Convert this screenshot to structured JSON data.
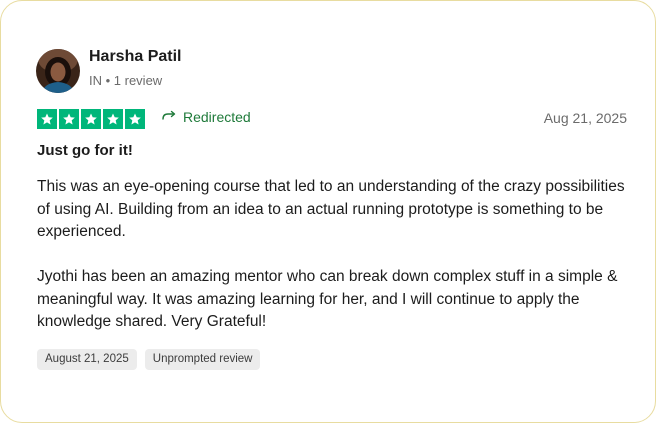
{
  "reviewer": {
    "name": "Harsha Patil",
    "meta": "IN • 1 review"
  },
  "rating": {
    "stars": 5,
    "max": 5,
    "star_color": "#00b67a"
  },
  "review": {
    "status_label": "Redirected",
    "status_icon": "redirect-arrow-icon",
    "status_color": "#1f7a3a",
    "date": "Aug 21, 2025",
    "title": "Just go for it!",
    "paragraphs": [
      "This was an eye-opening course that led to an understanding of the crazy possibilities of using AI. Building from an idea to an actual running prototype is something to be experienced.",
      "Jyothi has been an amazing mentor who can break down complex stuff in a simple & meaningful way. It was amazing learning for her, and I will continue to apply the knowledge shared. Very Grateful!"
    ],
    "tags": [
      "August 21, 2025",
      "Unprompted review"
    ]
  }
}
